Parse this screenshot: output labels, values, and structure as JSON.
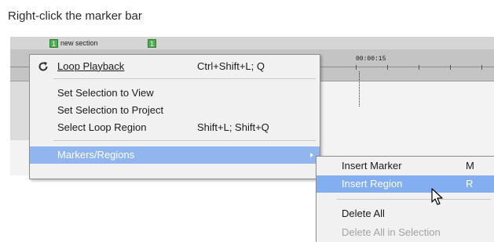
{
  "caption": "Right-click the marker bar",
  "marker_bar": {
    "markers": [
      {
        "number": "1",
        "label": "new section"
      },
      {
        "number": "1",
        "label": ""
      }
    ]
  },
  "ruler": {
    "timecode": "00:00:15"
  },
  "context_menu": {
    "items": [
      {
        "label": "Loop Playback",
        "mnemonic": "L",
        "shortcut": "Ctrl+Shift+L; Q",
        "icon": "loop-icon"
      },
      {
        "label": "Set Selection to View",
        "mnemonic": "V",
        "shortcut": ""
      },
      {
        "label": "Set Selection to Project",
        "mnemonic": "P",
        "shortcut": ""
      },
      {
        "label": "Select Loop Region",
        "mnemonic": "S",
        "shortcut": "Shift+L; Shift+Q"
      },
      {
        "label": "Markers/Regions",
        "mnemonic": "M",
        "shortcut": "",
        "highlighted": true,
        "has_submenu": true
      }
    ]
  },
  "submenu": {
    "items": [
      {
        "label": "Insert Marker",
        "mnemonic": "M",
        "shortcut": "M"
      },
      {
        "label": "Insert Region",
        "mnemonic": "R",
        "shortcut": "R",
        "highlighted": true
      },
      {
        "label": "Delete All",
        "mnemonic": "A",
        "shortcut": ""
      },
      {
        "label": "Delete All in Selection",
        "mnemonic": "S",
        "shortcut": "",
        "disabled": true
      }
    ]
  },
  "colors": {
    "highlight": "#91b5ee",
    "marker_green": "#4caf50",
    "menu_background": "#f1f1f1"
  }
}
